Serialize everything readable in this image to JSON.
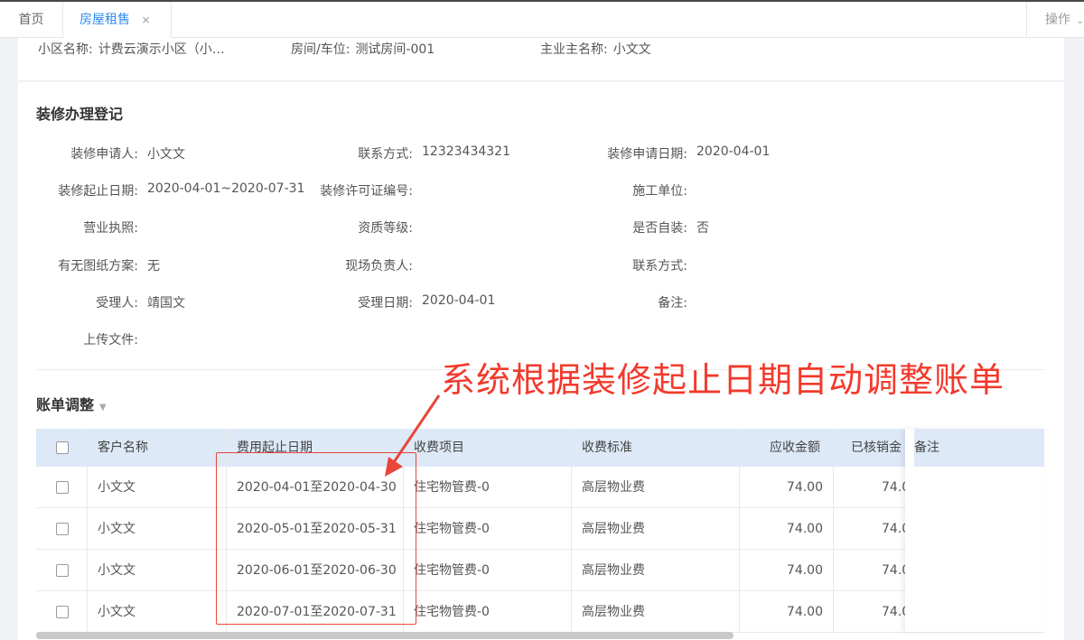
{
  "tabs": {
    "home": "首页",
    "rent": "房屋租售",
    "close": "×",
    "ops": "操作"
  },
  "house_info": {
    "community_label": "小区名称:",
    "community_value": "计费云演示小区（小…",
    "room_label": "房间/车位:",
    "room_value": "测试房间-001",
    "owner_label": "主业主名称:",
    "owner_value": "小文文"
  },
  "decoration": {
    "title": "装修办理登记",
    "fields": [
      {
        "label": "装修申请人:",
        "value": "小文文"
      },
      {
        "label": "联系方式:",
        "value": "12323434321"
      },
      {
        "label": "装修申请日期:",
        "value": "2020-04-01"
      },
      {
        "label": "装修起止日期:",
        "value": "2020-04-01~2020-07-31"
      },
      {
        "label": "装修许可证编号:",
        "value": ""
      },
      {
        "label": "施工单位:",
        "value": ""
      },
      {
        "label": "营业执照:",
        "value": ""
      },
      {
        "label": "资质等级:",
        "value": ""
      },
      {
        "label": "是否自装:",
        "value": "否"
      },
      {
        "label": "有无图纸方案:",
        "value": "无"
      },
      {
        "label": "现场负责人:",
        "value": ""
      },
      {
        "label": "联系方式:",
        "value": ""
      },
      {
        "label": "受理人:",
        "value": "靖国文"
      },
      {
        "label": "受理日期:",
        "value": "2020-04-01"
      },
      {
        "label": "备注:",
        "value": ""
      },
      {
        "label": "上传文件:",
        "value": ""
      }
    ]
  },
  "annotation": "系统根据装修起止日期自动调整账单",
  "bill": {
    "title": "账单调整",
    "columns": [
      "客户名称",
      "费用起止日期",
      "收费项目",
      "收费标准",
      "应收金额",
      "已核销金",
      "备注"
    ],
    "rows": [
      {
        "customer": "小文文",
        "period": "2020-04-01至2020-04-30",
        "item": "住宅物管费-0",
        "standard": "高层物业费",
        "receivable": "74.00",
        "written_off": "74.0"
      },
      {
        "customer": "小文文",
        "period": "2020-05-01至2020-05-31",
        "item": "住宅物管费-0",
        "standard": "高层物业费",
        "receivable": "74.00",
        "written_off": "74.0"
      },
      {
        "customer": "小文文",
        "period": "2020-06-01至2020-06-30",
        "item": "住宅物管费-0",
        "standard": "高层物业费",
        "receivable": "74.00",
        "written_off": "74.0"
      },
      {
        "customer": "小文文",
        "period": "2020-07-01至2020-07-31",
        "item": "住宅物管费-0",
        "standard": "高层物业费",
        "receivable": "74.00",
        "written_off": "74.0"
      }
    ]
  },
  "colors": {
    "accent": "#2d8cf0",
    "annotation": "#f23a2c",
    "table_header_bg": "#dde9f7"
  }
}
